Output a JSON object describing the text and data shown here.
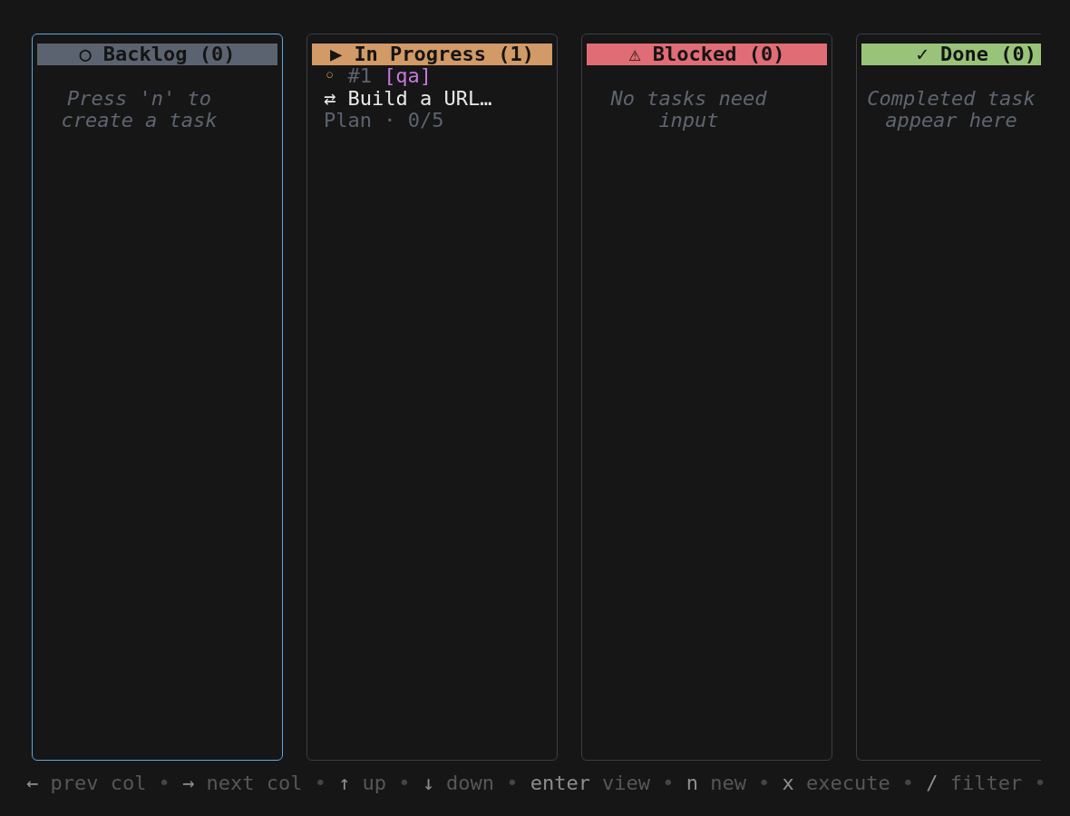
{
  "columns": [
    {
      "icon": "○",
      "title": "Backlog (0)",
      "color": "#5c6370",
      "selected": true,
      "empty_message": "Press 'n' to create a task"
    },
    {
      "icon": "▶",
      "title": "In Progress (1)",
      "color": "#d19a66",
      "selected": false,
      "tasks": [
        {
          "status_icon": "◦",
          "number": "#1",
          "tag": "[qa]",
          "type_icon": "⇄",
          "title": "Build a URL…",
          "progress": "Plan · 0/5"
        }
      ]
    },
    {
      "icon": "⚠",
      "title": "Blocked (0)",
      "color": "#e06c75",
      "selected": false,
      "empty_message": "No tasks need input"
    },
    {
      "icon": "✓",
      "title": "Done (0)",
      "color": "#98c379",
      "selected": false,
      "empty_message": "Completed task appear here"
    }
  ],
  "help": {
    "separator": "•",
    "items": [
      {
        "key": "←",
        "description": "prev col"
      },
      {
        "key": "→",
        "description": "next col"
      },
      {
        "key": "↑",
        "description": "up"
      },
      {
        "key": "↓",
        "description": "down"
      },
      {
        "key": "enter",
        "description": "view"
      },
      {
        "key": "n",
        "description": "new"
      },
      {
        "key": "x",
        "description": "execute"
      },
      {
        "key": "/",
        "description": "filter"
      }
    ]
  }
}
